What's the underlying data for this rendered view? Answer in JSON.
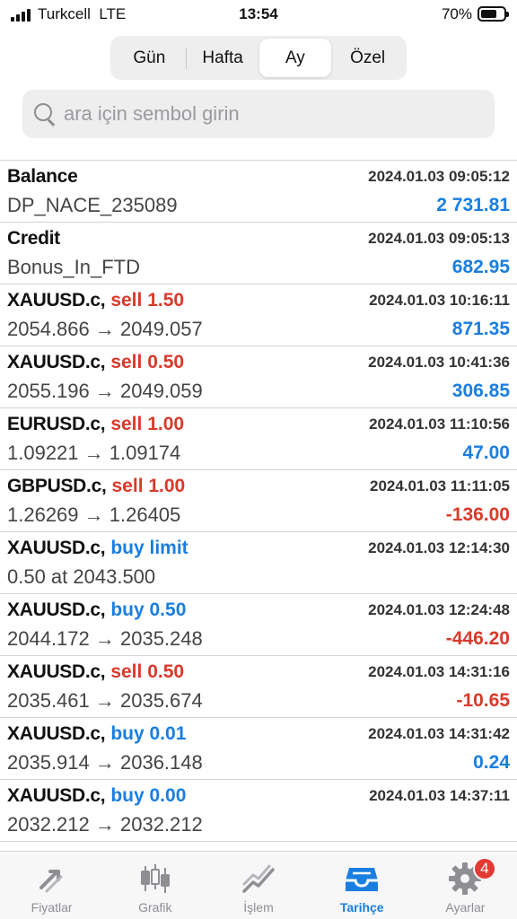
{
  "status_bar": {
    "carrier": "Turkcell",
    "network": "LTE",
    "time": "13:54",
    "battery": "70%",
    "battery_level": 0.7
  },
  "period_tabs": [
    {
      "label": "Gün",
      "active": false
    },
    {
      "label": "Hafta",
      "active": false
    },
    {
      "label": "Ay",
      "active": true
    },
    {
      "label": "Özel",
      "active": false
    }
  ],
  "search": {
    "placeholder": "ara için sembol girin"
  },
  "history": [
    {
      "symbol": "Balance",
      "side": "",
      "side_type": "",
      "time": "2024.01.03 09:05:12",
      "detail": "DP_NACE_235089",
      "profit": "2 731.81",
      "profit_type": "pos"
    },
    {
      "symbol": "Credit",
      "side": "",
      "side_type": "",
      "time": "2024.01.03 09:05:13",
      "detail": "Bonus_In_FTD",
      "profit": "682.95",
      "profit_type": "pos"
    },
    {
      "symbol": "XAUUSD.c,",
      "side": "sell 1.50",
      "side_type": "sell",
      "time": "2024.01.03 10:16:11",
      "detail": "2054.866 → 2049.057",
      "profit": "871.35",
      "profit_type": "pos"
    },
    {
      "symbol": "XAUUSD.c,",
      "side": "sell 0.50",
      "side_type": "sell",
      "time": "2024.01.03 10:41:36",
      "detail": "2055.196 → 2049.059",
      "profit": "306.85",
      "profit_type": "pos"
    },
    {
      "symbol": "EURUSD.c,",
      "side": "sell 1.00",
      "side_type": "sell",
      "time": "2024.01.03 11:10:56",
      "detail": "1.09221 → 1.09174",
      "profit": "47.00",
      "profit_type": "pos"
    },
    {
      "symbol": "GBPUSD.c,",
      "side": "sell 1.00",
      "side_type": "sell",
      "time": "2024.01.03 11:11:05",
      "detail": "1.26269 → 1.26405",
      "profit": "-136.00",
      "profit_type": "neg"
    },
    {
      "symbol": "XAUUSD.c,",
      "side": "buy limit",
      "side_type": "buy",
      "time": "2024.01.03 12:14:30",
      "detail": "0.50 at 2043.500",
      "profit": "",
      "profit_type": ""
    },
    {
      "symbol": "XAUUSD.c,",
      "side": "buy 0.50",
      "side_type": "buy",
      "time": "2024.01.03 12:24:48",
      "detail": "2044.172 → 2035.248",
      "profit": "-446.20",
      "profit_type": "neg"
    },
    {
      "symbol": "XAUUSD.c,",
      "side": "sell 0.50",
      "side_type": "sell",
      "time": "2024.01.03 14:31:16",
      "detail": "2035.461 → 2035.674",
      "profit": "-10.65",
      "profit_type": "neg"
    },
    {
      "symbol": "XAUUSD.c,",
      "side": "buy 0.01",
      "side_type": "buy",
      "time": "2024.01.03 14:31:42",
      "detail": "2035.914 → 2036.148",
      "profit": "0.24",
      "profit_type": "pos"
    },
    {
      "symbol": "XAUUSD.c,",
      "side": "buy 0.00",
      "side_type": "buy",
      "time": "2024.01.03 14:37:11",
      "detail": "2032.212 → 2032.212",
      "profit": "",
      "profit_type": ""
    }
  ],
  "tabbar": [
    {
      "label": "Fiyatlar",
      "icon": "price-arrows-icon",
      "active": false
    },
    {
      "label": "Grafik",
      "icon": "candlestick-icon",
      "active": false
    },
    {
      "label": "İşlem",
      "icon": "trade-chart-icon",
      "active": false
    },
    {
      "label": "Tarihçe",
      "icon": "inbox-icon",
      "active": true
    },
    {
      "label": "Ayarlar",
      "icon": "gear-icon",
      "active": false,
      "badge": "4"
    }
  ],
  "colors": {
    "accent": "#1a7ee0",
    "sell": "#d93a2b",
    "inactive": "#8e8e93"
  }
}
